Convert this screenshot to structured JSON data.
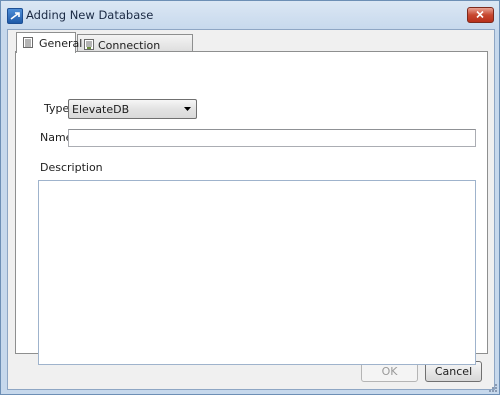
{
  "window": {
    "title": "Adding New Database",
    "title_icon": "app-icon",
    "close_icon": "close-icon"
  },
  "tabs": [
    {
      "label": "General",
      "icon": "general-tab-icon",
      "active": true
    },
    {
      "label": "Connection Properties",
      "icon": "connection-tab-icon",
      "active": false
    }
  ],
  "form": {
    "type_label": "Type",
    "type_value": "ElevateDB",
    "name_label": "Name",
    "name_value": "",
    "description_label": "Description",
    "description_value": ""
  },
  "buttons": {
    "ok_label": "OK",
    "ok_enabled": false,
    "cancel_label": "Cancel"
  }
}
